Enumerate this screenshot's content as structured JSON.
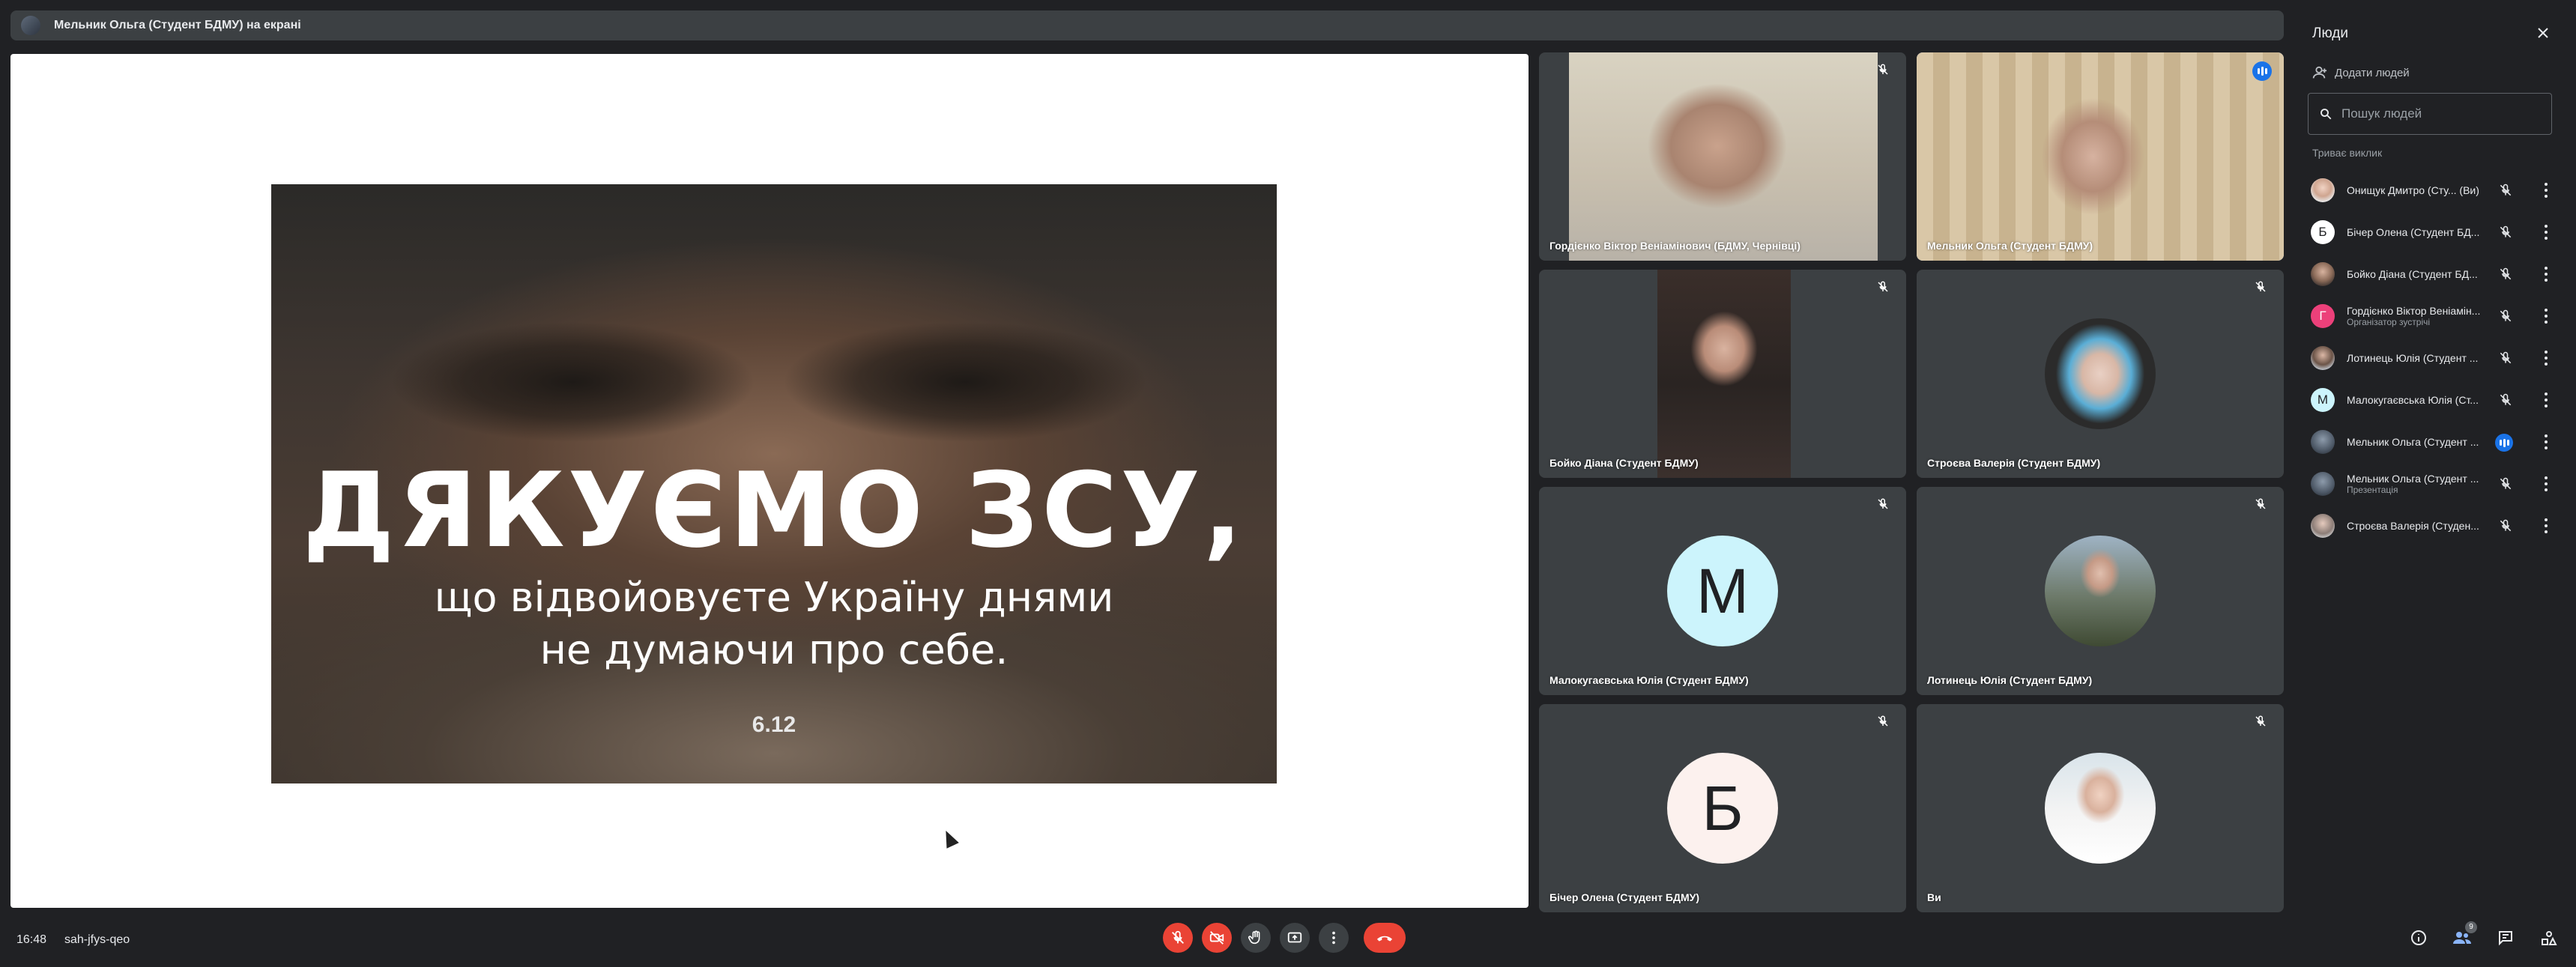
{
  "presenting_bar": {
    "text": "Мельник Ольга (Студент БДМУ) на екрані"
  },
  "slide": {
    "headline": "ДЯКУЄМО ЗСУ,",
    "line1": "що відвойовуєте Україну днями",
    "line2": "не думаючи про себе.",
    "date": "6.12"
  },
  "tiles": [
    {
      "name": "Гордієнко Віктор Веніамінович (БДМУ, Чернівці)",
      "type": "video",
      "mic": "off"
    },
    {
      "name": "Мельник Ольга (Студент БДМУ)",
      "type": "video",
      "mic": "speaking"
    },
    {
      "name": "Бойко Діана (Студент БДМУ)",
      "type": "video",
      "mic": "off"
    },
    {
      "name": "Строєва Валерія (Студент БДМУ)",
      "type": "photo",
      "mic": "off"
    },
    {
      "name": "Малокугаєвська Юлія (Студент БДМУ)",
      "type": "letter",
      "letter": "М",
      "color": "#ccf4fc",
      "mic": "off"
    },
    {
      "name": "Лотинець Юлія (Студент БДМУ)",
      "type": "photo",
      "mic": "off"
    },
    {
      "name": "Бічер Олена (Студент БДМУ)",
      "type": "letter",
      "letter": "Б",
      "color": "#fcf1ee",
      "mic": "off"
    },
    {
      "name": "Ви",
      "type": "photo",
      "mic": "off"
    }
  ],
  "people_panel": {
    "title": "Люди",
    "add_people": "Додати людей",
    "search_placeholder": "Пошук людей",
    "section": "Триває виклик",
    "participants": [
      {
        "name": "Онищук Дмитро (Сту... (Ви)",
        "role": "",
        "avatar": "photo",
        "mic": "off"
      },
      {
        "name": "Бічер Олена (Студент БД...",
        "role": "",
        "avatar": "Б",
        "color": "#ffffff",
        "mic": "off"
      },
      {
        "name": "Бойко Діана (Студент БД...",
        "role": "",
        "avatar": "photo",
        "mic": "off"
      },
      {
        "name": "Гордієнко Віктор Веніамін...",
        "role": "Організатор зустрічі",
        "avatar": "Г",
        "color": "#ec407a",
        "mic": "off"
      },
      {
        "name": "Лотинець Юлія (Студент ...",
        "role": "",
        "avatar": "photo",
        "mic": "off"
      },
      {
        "name": "Малокугаєвська Юлія (Ст...",
        "role": "",
        "avatar": "М",
        "color": "#ccf4fc",
        "mic": "off"
      },
      {
        "name": "Мельник Ольга (Студент ...",
        "role": "",
        "avatar": "photo",
        "mic": "speaking"
      },
      {
        "name": "Мельник Ольга (Студент ...",
        "role": "Презентація",
        "avatar": "photo",
        "mic": "off"
      },
      {
        "name": "Строєва Валерія (Студен...",
        "role": "",
        "avatar": "photo",
        "mic": "off"
      }
    ]
  },
  "bottom_bar": {
    "time": "16:48",
    "meeting_code": "sah-jfys-qeo",
    "people_count": "9"
  }
}
